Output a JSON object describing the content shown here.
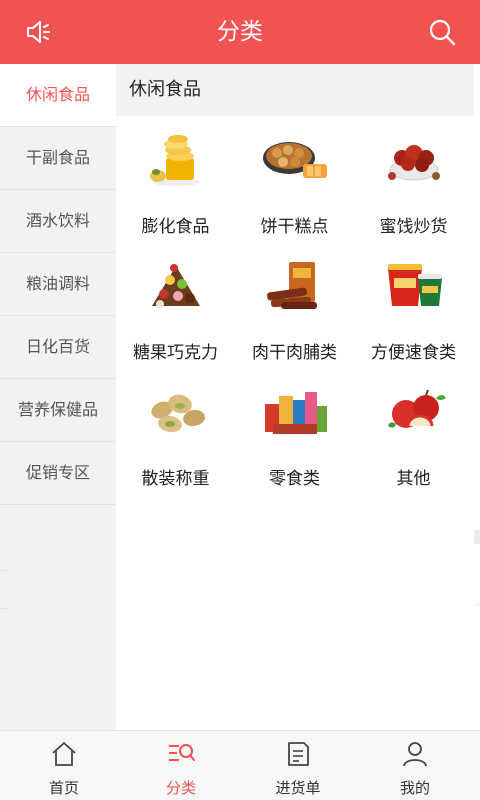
{
  "header": {
    "title": "分类",
    "left_icon": "speaker-icon",
    "right_icon": "search-icon"
  },
  "sidebar": {
    "items": [
      {
        "label": "休闲食品",
        "active": true
      },
      {
        "label": "干副食品",
        "active": false
      },
      {
        "label": "酒水饮料",
        "active": false
      },
      {
        "label": "粮油调料",
        "active": false
      },
      {
        "label": "日化百货",
        "active": false
      },
      {
        "label": "营养保健品",
        "active": false
      },
      {
        "label": "促销专区",
        "active": false
      }
    ]
  },
  "main": {
    "section_title": "休闲食品",
    "categories": [
      {
        "label": "膨化食品",
        "icon": "chips-icon"
      },
      {
        "label": "饼干糕点",
        "icon": "cookies-icon"
      },
      {
        "label": "蜜饯炒货",
        "icon": "dried-fruit-icon"
      },
      {
        "label": "糖果巧克力",
        "icon": "chocolate-icon"
      },
      {
        "label": "肉干肉脯类",
        "icon": "jerky-icon"
      },
      {
        "label": "方便速食类",
        "icon": "instant-noodle-icon"
      },
      {
        "label": "散装称重",
        "icon": "nuts-icon"
      },
      {
        "label": "零食类",
        "icon": "snacks-icon"
      },
      {
        "label": "其他",
        "icon": "apple-icon"
      }
    ]
  },
  "tabbar": {
    "tabs": [
      {
        "label": "首页",
        "icon": "home-icon",
        "active": false
      },
      {
        "label": "分类",
        "icon": "category-icon",
        "active": true
      },
      {
        "label": "进货单",
        "icon": "order-list-icon",
        "active": false
      },
      {
        "label": "我的",
        "icon": "user-icon",
        "active": false
      }
    ]
  },
  "colors": {
    "brand": "#f15353",
    "sidebar_bg": "#f2f2f2",
    "text": "#333333"
  }
}
